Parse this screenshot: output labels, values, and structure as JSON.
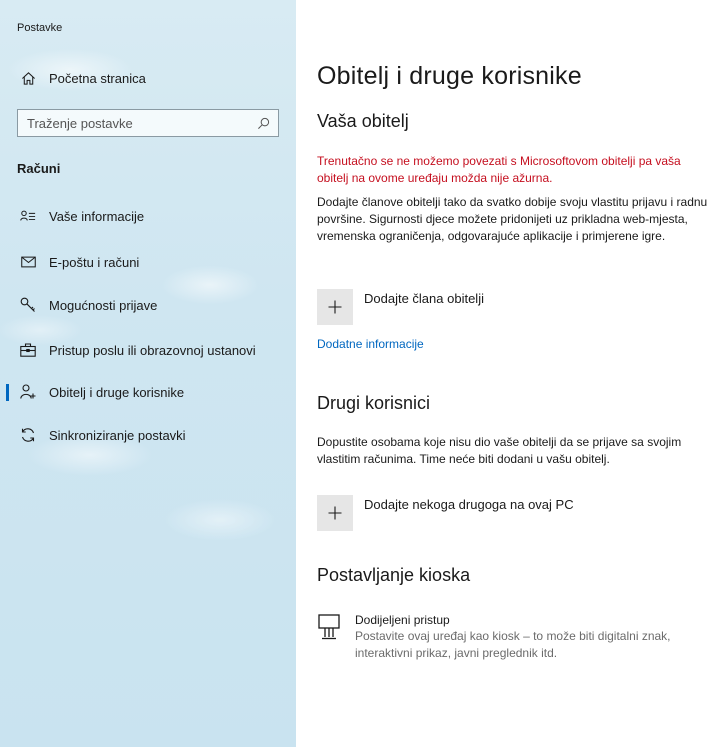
{
  "window": {
    "title": "Postavke"
  },
  "sidebar": {
    "home_label": "Početna stranica",
    "search": {
      "placeholder": "Traženje postavke"
    },
    "section_title": "Računi",
    "items": [
      {
        "label": "Vaše informacije",
        "icon": "person-info-icon",
        "selected": false
      },
      {
        "label": "E-poštu i računi",
        "icon": "mail-icon",
        "selected": false
      },
      {
        "label": "Mogućnosti prijave",
        "icon": "key-icon",
        "selected": false
      },
      {
        "label": "Pristup poslu ili obrazovnoj ustanovi",
        "icon": "briefcase-icon",
        "selected": false
      },
      {
        "label": "Obitelj i druge korisnike",
        "icon": "add-person-icon",
        "selected": true
      },
      {
        "label": "Sinkroniziranje postavki",
        "icon": "sync-icon",
        "selected": false
      }
    ],
    "accent_color": "#0067c0"
  },
  "main": {
    "title": "Obitelj i druge korisnike",
    "family": {
      "heading": "Vaša obitelj",
      "error": "Trenutačno se ne možemo povezati s Microsoftovom obitelji pa vaša obitelj na ovome uređaju možda nije ažurna.",
      "description": "Dodajte članove obitelji tako da svatko dobije svoju vlastitu prijavu i radnu površine. Sigurnosti djece možete pridonijeti uz prikladna web-mjesta, vremenska ograničenja, odgovarajuće aplikacije i primjerene igre.",
      "add_label": "Dodajte člana obitelji",
      "more_info_link": "Dodatne informacije"
    },
    "others": {
      "heading": "Drugi korisnici",
      "description": "Dopustite osobama koje nisu dio vaše obitelji da se prijave sa svojim vlastitim računima. Time neće biti dodani u vašu obitelj.",
      "add_label": "Dodajte nekoga drugoga na ovaj PC"
    },
    "kiosk": {
      "heading": "Postavljanje kioska",
      "item_title": "Dodijeljeni pristup",
      "item_description": "Postavite ovaj uređaj kao kiosk – to može biti digitalni znak, interaktivni prikaz, javni preglednik itd."
    },
    "error_color": "#c50f1f",
    "link_color": "#0067c0"
  }
}
